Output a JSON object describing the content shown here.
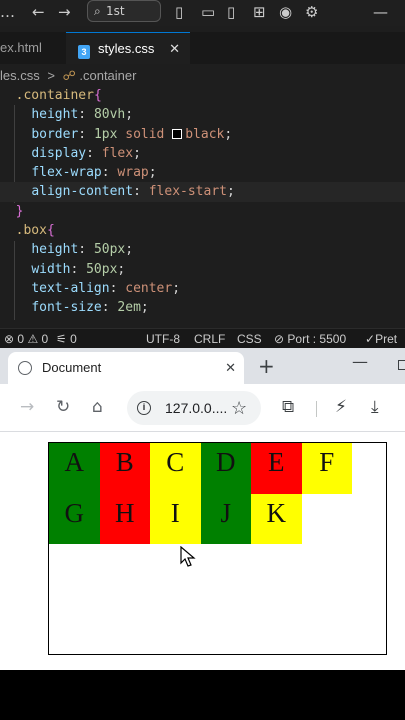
{
  "vscode": {
    "titlebar": {
      "search_text": "1st",
      "icons": [
        "back-arrow-icon",
        "forward-arrow-icon",
        "search-icon",
        "toggle-sidebar-icon",
        "toggle-panel-icon",
        "toggle-secondary-sidebar-icon",
        "customize-layout-icon",
        "account-icon",
        "settings-gear-icon",
        "minimize-icon"
      ]
    },
    "tabs": [
      {
        "label": "ex.html",
        "active": false
      },
      {
        "label": "styles.css",
        "active": true
      }
    ],
    "breadcrumb": {
      "file": "les.css",
      "separator": ">",
      "symbol": ".container"
    },
    "code": [
      {
        "sel": ".container",
        "open": "{"
      },
      {
        "prop": "height",
        "num": "80",
        "unit": "vh"
      },
      {
        "prop": "border",
        "num": "1",
        "unit": "px",
        "rest": "solid",
        "color": "black"
      },
      {
        "prop": "display",
        "val": "flex"
      },
      {
        "prop": "flex-wrap",
        "val": "wrap"
      },
      {
        "prop": "align-content",
        "val": "flex-start"
      },
      {
        "close": "}"
      },
      {
        "sel": ".box",
        "open": "{"
      },
      {
        "prop": "height",
        "num": "50",
        "unit": "px"
      },
      {
        "prop": "width",
        "num": "50",
        "unit": "px"
      },
      {
        "prop": "text-align",
        "val": "center"
      },
      {
        "prop": "font-size",
        "num": "2",
        "unit": "em"
      }
    ],
    "status": {
      "errors": "0",
      "warnings": "0",
      "ports": "0",
      "encoding": "UTF-8",
      "eol": "CRLF",
      "language": "CSS",
      "port": "Port : 5500",
      "prettier": "Pret"
    }
  },
  "chrome": {
    "tab_title": "Document",
    "url": "127.0.0....",
    "boxes": [
      {
        "letter": "A",
        "color": "#008000"
      },
      {
        "letter": "B",
        "color": "#ff0000"
      },
      {
        "letter": "C",
        "color": "#ffff00"
      },
      {
        "letter": "D",
        "color": "#008000"
      },
      {
        "letter": "E",
        "color": "#ff0000"
      },
      {
        "letter": "F",
        "color": "#ffff00"
      },
      {
        "letter": "G",
        "color": "#008000"
      },
      {
        "letter": "H",
        "color": "#ff0000"
      },
      {
        "letter": "I",
        "color": "#ffff00"
      },
      {
        "letter": "J",
        "color": "#008000"
      },
      {
        "letter": "K",
        "color": "#ffff00"
      }
    ]
  }
}
